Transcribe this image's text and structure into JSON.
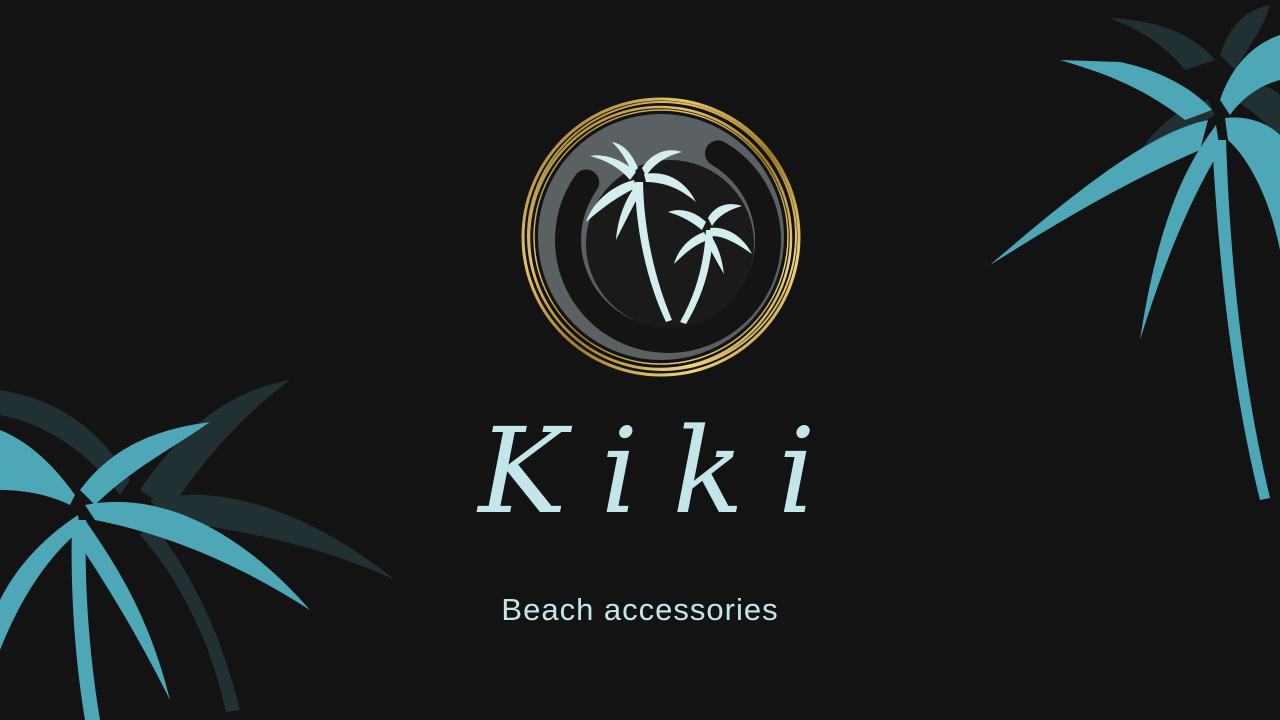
{
  "brand": {
    "name": "Kiki",
    "tagline": "Beach accessories"
  },
  "colors": {
    "background": "#131313",
    "palm_teal": "#4ea7b6",
    "palm_shadow": "#203033",
    "gold": "#c9a24a",
    "badge_fill": "#5b6063",
    "text_light": "#c4e6ea"
  },
  "icons": {
    "badge_icon": "palm-trees-icon",
    "decor_icons": [
      "palm-tree-icon"
    ]
  }
}
